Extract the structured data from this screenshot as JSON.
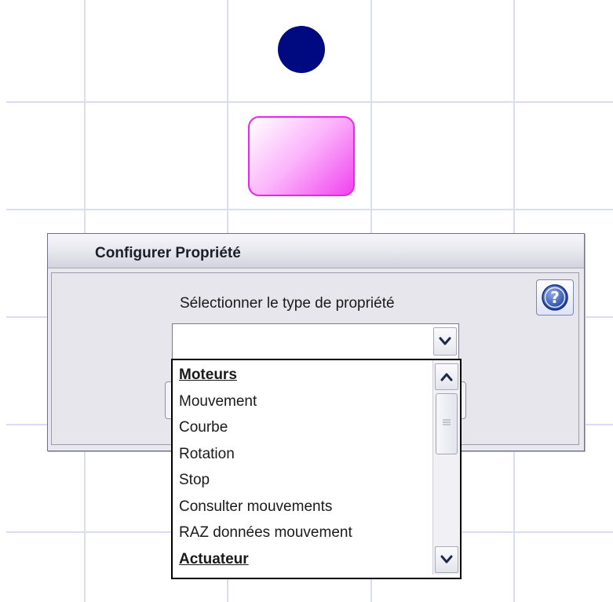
{
  "dialog": {
    "title": "Configurer Propriété",
    "prompt": "Sélectionner le type de propriété",
    "help_button_label": "?"
  },
  "combobox": {
    "value": ""
  },
  "dropdown": {
    "items": [
      {
        "label": "Moteurs",
        "header": true
      },
      {
        "label": "Mouvement",
        "header": false
      },
      {
        "label": "Courbe",
        "header": false
      },
      {
        "label": "Rotation",
        "header": false
      },
      {
        "label": "Stop",
        "header": false
      },
      {
        "label": "Consulter mouvements",
        "header": false
      },
      {
        "label": "RAZ données mouvement",
        "header": false
      },
      {
        "label": "Actuateur",
        "header": true
      }
    ]
  },
  "icons": {
    "help": "help-icon",
    "combo_arrow": "chevron-down-icon",
    "scroll_up": "chevron-up-icon",
    "scroll_down": "chevron-down-icon"
  },
  "colors": {
    "circle_node": "#000a80",
    "rect_node_border": "#ee22ee",
    "grid": "#d9dcf5",
    "dialog_bg": "#e8e8ee"
  }
}
